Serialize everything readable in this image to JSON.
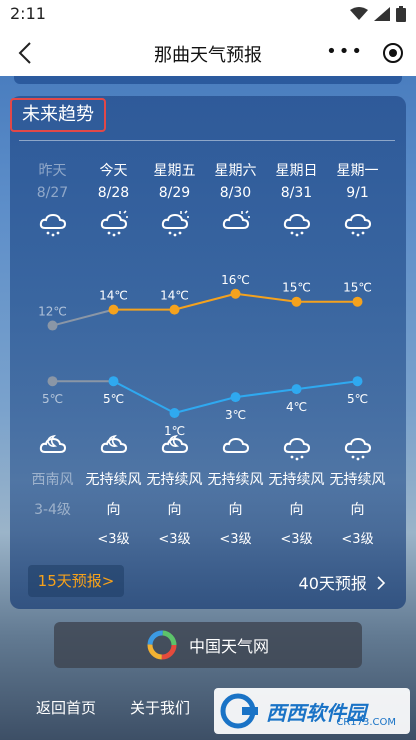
{
  "status_bar": {
    "time": "2:11"
  },
  "nav": {
    "title": "那曲天气预报"
  },
  "section": {
    "title": "未来趋势"
  },
  "days": [
    {
      "day": "昨天",
      "date": "8/27",
      "past": true,
      "icon_top": "cloud-rain-icon",
      "icon_bottom": "cloud-moon-icon",
      "high": "12℃",
      "low": "5℃",
      "wind": "西南风",
      "level": "3-4级"
    },
    {
      "day": "今天",
      "date": "8/28",
      "past": false,
      "icon_top": "sun-cloud-rain-icon",
      "icon_bottom": "cloud-moon-icon",
      "high": "14℃",
      "low": "5℃",
      "wind": "无持续风",
      "dir": "向",
      "level": "<3级"
    },
    {
      "day": "星期五",
      "date": "8/29",
      "past": false,
      "icon_top": "sun-cloud-rain-icon",
      "icon_bottom": "cloud-moon-icon",
      "high": "14℃",
      "low": "1℃",
      "wind": "无持续风",
      "dir": "向",
      "level": "<3级"
    },
    {
      "day": "星期六",
      "date": "8/30",
      "past": false,
      "icon_top": "sun-cloud-icon",
      "icon_bottom": "cloud-icon",
      "high": "16℃",
      "low": "3℃",
      "wind": "无持续风",
      "dir": "向",
      "level": "<3级"
    },
    {
      "day": "星期日",
      "date": "8/31",
      "past": false,
      "icon_top": "cloud-rain-icon",
      "icon_bottom": "cloud-rain-icon",
      "high": "15℃",
      "low": "4℃",
      "wind": "无持续风",
      "dir": "向",
      "level": "<3级"
    },
    {
      "day": "星期一",
      "date": "9/1",
      "past": false,
      "icon_top": "cloud-rain-icon",
      "icon_bottom": "cloud-rain-icon",
      "high": "15℃",
      "low": "5℃",
      "wind": "无持续风",
      "dir": "向",
      "level": "<3级"
    }
  ],
  "chart_data": {
    "type": "line",
    "categories": [
      "8/27",
      "8/28",
      "8/29",
      "8/30",
      "8/31",
      "9/1"
    ],
    "series": [
      {
        "values": [
          12,
          14,
          14,
          16,
          15,
          15
        ],
        "color": "#f4a21e"
      },
      {
        "values": [
          5,
          5,
          1,
          3,
          4,
          5
        ],
        "color": "#2fa9f0"
      }
    ],
    "past_color": "#8a96a6"
  },
  "buttons": {
    "forecast15": "15天预报>",
    "forecast40": "40天预报"
  },
  "brand": {
    "name": "中国天气网"
  },
  "footer": {
    "home": "返回首页",
    "about": "关于我们"
  },
  "watermark": {
    "text": "西西软件园",
    "url": "CR173.COM"
  },
  "colors": {
    "accent_orange": "#f4a21e",
    "accent_blue": "#2fa9f0",
    "highlight_border": "#e24848"
  }
}
